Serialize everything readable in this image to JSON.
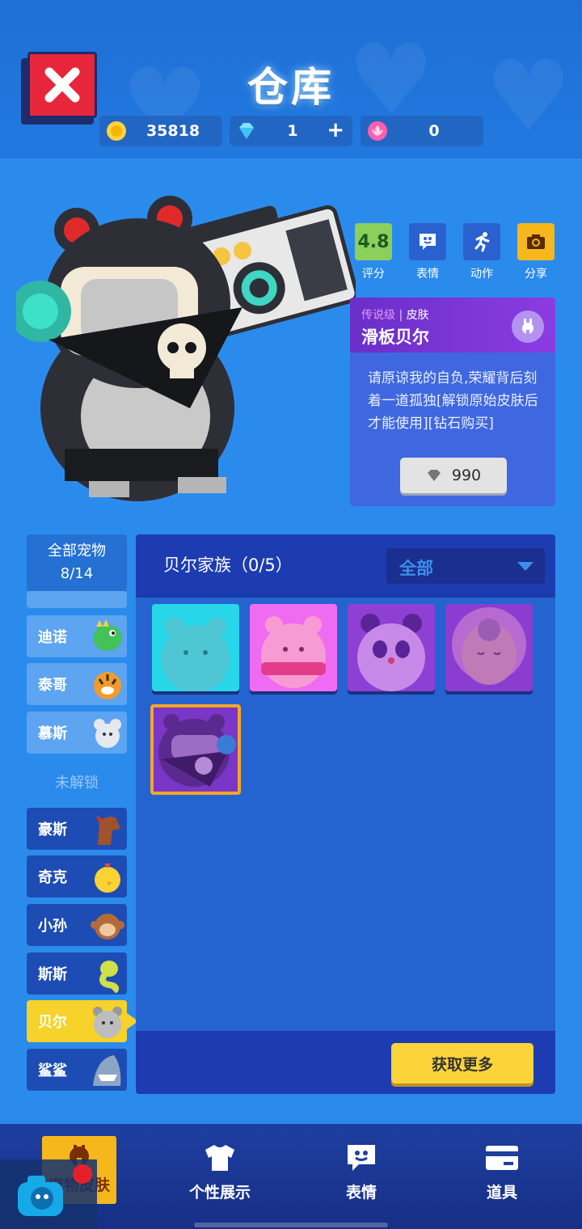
{
  "header": {
    "title": "仓库",
    "coins": "35818",
    "diamonds": "1",
    "flowers": "0"
  },
  "actions": [
    {
      "label": "评分",
      "value": "4.8"
    },
    {
      "label": "表情"
    },
    {
      "label": "动作"
    },
    {
      "label": "分享"
    }
  ],
  "skin_card": {
    "rarity": "传说级",
    "separator": "|",
    "type": "皮肤",
    "name": "滑板贝尔",
    "description": "请原谅我的自负,荣耀背后刻着一道孤独[解锁原始皮肤后才能使用][钻石购买]",
    "price": "990"
  },
  "left_list": {
    "all_pets_title": "全部宠物",
    "all_pets_count": "8/14",
    "unlocked": [
      "迪诺",
      "泰哥",
      "慕斯"
    ],
    "locked_label": "未解锁",
    "locked": [
      "豪斯",
      "奇克",
      "小孙",
      "斯斯",
      "贝尔",
      "鲨鲨"
    ],
    "selected": "贝尔"
  },
  "skin_panel": {
    "family": "贝尔家族（0/5）",
    "filter": "全部",
    "more_button": "获取更多"
  },
  "nav": {
    "items": [
      "宠物皮肤",
      "个性展示",
      "表情",
      "道具"
    ],
    "active": "宠物皮肤"
  },
  "colors": {
    "background": "#2b8bec",
    "header": "#1f6fd6",
    "close": "#e8263b",
    "selected_pet": "#f6d22a",
    "more_button": "#fbd43a",
    "legendary": "#8b3ce2"
  }
}
